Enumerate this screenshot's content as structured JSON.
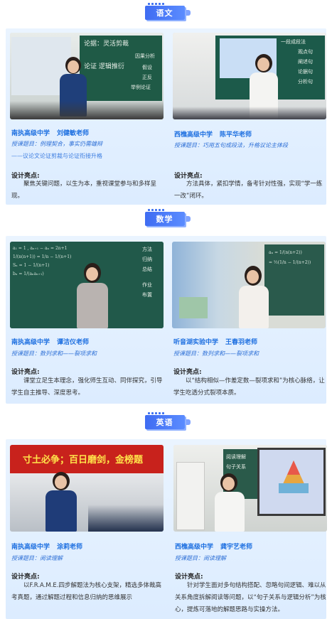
{
  "sections": [
    {
      "tag": "语文",
      "cards": [
        {
          "school": "南执高级中学",
          "teacher": "刘健敏老师",
          "topic": "授课题目：例理契合，事实仍需雄辩",
          "subtitle": "——议论文论证剪裁与论证衔接升格",
          "highlight_title": "设计亮点:",
          "highlight_text": "聚焦关键问题，以生为本，重视课堂参与和多样呈现。",
          "board_text": [
            "论据：灵活剪裁",
            "论证  逻辑推衍",
            "因果分析",
            "假设",
            "正反",
            "举例论证"
          ]
        },
        {
          "school": "西樵高级中学",
          "teacher": "陈平华老师",
          "topic": "授课题目：巧用五句成段法，升格议论主体段",
          "highlight_title": "设计亮点:",
          "highlight_text": "方法具体，紧扣学情，备考针对性强，实现“学一练一改”闭环。",
          "board_text": [
            "一段成段法",
            "观点句",
            "阐述句",
            "论据句",
            "分析句"
          ]
        }
      ]
    },
    {
      "tag": "数学",
      "cards": [
        {
          "school": "南执高级中学",
          "teacher": "谭洁仪老师",
          "topic": "授课题目：数列求和——裂项求和",
          "highlight_title": "设计亮点:",
          "highlight_text": "课堂立足生本理念，强化师生互动、同伴探究，引导学生自主推导、深度思考。",
          "board_text": [
            "方法",
            "归纳",
            "总结",
            "作业",
            "布置"
          ]
        },
        {
          "school": "听音湖实验中学",
          "teacher": "王春羽老师",
          "topic": "授课题目：数列求和——裂项求和",
          "highlight_title": "设计亮点:",
          "highlight_text": "以“结构相似—作差定数—裂项求和”为核心脉络，让学生吃透分式裂项本质。",
          "board_text": []
        }
      ]
    },
    {
      "tag": "英语",
      "cards": [
        {
          "school": "南执高级中学",
          "teacher": "涂莉老师",
          "topic": "授课题目：阅读理解",
          "highlight_title": "设计亮点:",
          "highlight_text": "以F.R.A.M.E.四步解题法为核心支架，精选多体裁高考真题，通过解题过程和信息归纳的思维展示",
          "board_text": [
            "寸土必争；百日磨剑，金榜题"
          ]
        },
        {
          "school": "西樵高级中学",
          "teacher": "龚宇艺老师",
          "topic": "授课题目：阅读理解",
          "highlight_title": "设计亮点:",
          "highlight_text": "针对学生面对多句结构搭配、忽略句间逻辑、难以从关系角度拆解阅读等问题，以“句子关系与逻辑分析”为核心，提炼可落地的解题思路与实操方法。",
          "board_text": [
            "阅读理解",
            "句子关系"
          ]
        }
      ]
    }
  ],
  "colors": {
    "accent": "#3f6cf2",
    "name": "#1d6fe0",
    "section_bg": "#e3f0ff"
  }
}
